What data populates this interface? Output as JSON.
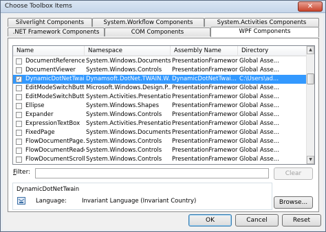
{
  "window": {
    "title": "Choose Toolbox Items",
    "close_glyph": "✕"
  },
  "tabs": {
    "row_back": [
      "Silverlight Components",
      "System.Workflow Components",
      "System.Activities Components"
    ],
    "row_front": [
      ".NET Framework Components",
      "COM Components",
      "WPF Components"
    ],
    "active": "WPF Components"
  },
  "list": {
    "columns": [
      "Name",
      "Namespace",
      "Assembly Name",
      "Directory"
    ],
    "rows": [
      {
        "checked": false,
        "name": "DocumentReference",
        "namespace": "System.Windows.Documents",
        "assembly": "PresentationFramework",
        "directory": "Global Asse..."
      },
      {
        "checked": false,
        "name": "DocumentViewer",
        "namespace": "System.Windows.Controls",
        "assembly": "PresentationFramework",
        "directory": "Global Asse..."
      },
      {
        "checked": true,
        "selected": true,
        "name": "DynamicDotNetTwain",
        "namespace": "Dynamsoft.DotNet.TWAIN.W...",
        "assembly": "DynamicDotNetTwai...",
        "directory": "C:\\Users\\ad..."
      },
      {
        "checked": false,
        "name": "EditModeSwitchButt...",
        "namespace": "Microsoft.Windows.Design.P...",
        "assembly": "PresentationFramework",
        "directory": "Global Asse..."
      },
      {
        "checked": false,
        "name": "EditModeSwitchButt...",
        "namespace": "System.Activities.Presentatio...",
        "assembly": "PresentationFramework",
        "directory": "Global Asse..."
      },
      {
        "checked": false,
        "name": "Ellipse",
        "namespace": "System.Windows.Shapes",
        "assembly": "PresentationFramework",
        "directory": "Global Asse..."
      },
      {
        "checked": false,
        "name": "Expander",
        "namespace": "System.Windows.Controls",
        "assembly": "PresentationFramework",
        "directory": "Global Asse..."
      },
      {
        "checked": false,
        "name": "ExpressionTextBox",
        "namespace": "System.Activities.Presentatio...",
        "assembly": "PresentationFramework",
        "directory": "Global Asse..."
      },
      {
        "checked": false,
        "name": "FixedPage",
        "namespace": "System.Windows.Documents",
        "assembly": "PresentationFramework",
        "directory": "Global Asse..."
      },
      {
        "checked": false,
        "name": "FlowDocumentPage...",
        "namespace": "System.Windows.Controls",
        "assembly": "PresentationFramework",
        "directory": "Global Asse..."
      },
      {
        "checked": false,
        "name": "FlowDocumentReader",
        "namespace": "System.Windows.Controls",
        "assembly": "PresentationFramework",
        "directory": "Global Asse..."
      },
      {
        "checked": false,
        "name": "FlowDocumentScroll...",
        "namespace": "System.Windows.Controls",
        "assembly": "PresentationFramework",
        "directory": "Global Asse..."
      }
    ]
  },
  "filter": {
    "label": "Filter:",
    "value": "",
    "clear_label": "Clear"
  },
  "info": {
    "component_name": "DynamicDotNetTwain",
    "language_label": "Language:",
    "language_value": "Invariant Language (Invariant Country)",
    "browse_label": "Browse..."
  },
  "footer": {
    "ok_label": "OK",
    "cancel_label": "Cancel",
    "reset_label": "Reset"
  },
  "colors": {
    "selection": "#3399ff",
    "dialog_bg": "#f0f0f0",
    "close_button": "#c9442c"
  },
  "icons": {
    "close": "close-icon",
    "check": "checkmark-icon",
    "scroll_up": "scroll-up-arrow-icon",
    "scroll_down": "scroll-down-arrow-icon",
    "component": "component-icon"
  }
}
